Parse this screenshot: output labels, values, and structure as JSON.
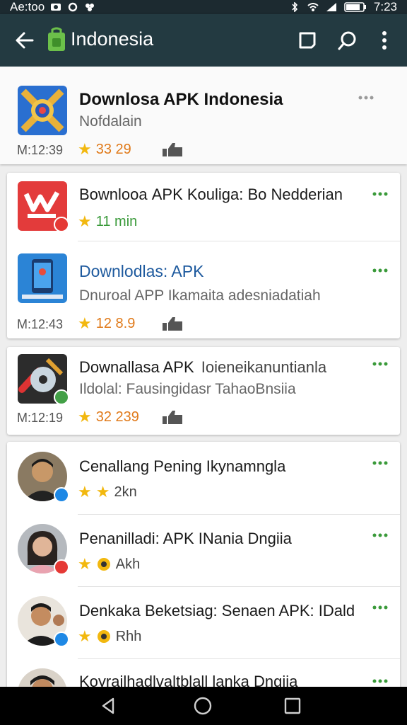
{
  "status_bar": {
    "left_text": "Ae:too",
    "time": "7:23"
  },
  "app_bar": {
    "title": "Indonesia"
  },
  "items": [
    {
      "title": "Downlosa APK Indonesia",
      "subtitle": "Nofdalain",
      "size": "M:12:39",
      "rating": "33 29"
    },
    {
      "title": "Bownlooа APK Kouliga: Bo Nedderian",
      "rating": "11 min"
    },
    {
      "title": "Downlodlas: APK",
      "subtitle": "Dnuroal APP Ikamaita adesniadatiah",
      "size": "M:12:43",
      "rating": "12 8.9"
    },
    {
      "title": "Downallasa APK",
      "title_suffix": "Ioieneikanuntianla",
      "subtitle": "Ildolal: Fausingidasr TahaoBnsiia",
      "size": "M:12:19",
      "rating": "32 239"
    },
    {
      "title": "Cenallang Pening Ikynamngla",
      "rating": "2kn"
    },
    {
      "title": "Penanilladi: APK INania Dngiia",
      "rating": "Akh"
    },
    {
      "title": "Denkaka Beketsiag: Senaen APK: IDald",
      "rating": "Rhh"
    },
    {
      "title": "Koyrailhadlvaltblall lanka Dngiia"
    }
  ],
  "colors": {
    "app_bar": "#233a41",
    "accent_green": "#3a9a3a",
    "star": "#f2b80f",
    "link_blue": "#1e5a9e",
    "rating_orange": "#e07a1a"
  }
}
